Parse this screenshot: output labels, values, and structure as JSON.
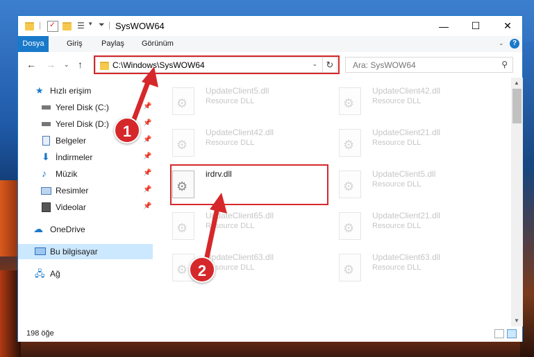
{
  "window": {
    "title": "SysWOW64"
  },
  "ribbon": {
    "tabs": [
      "Dosya",
      "Giriş",
      "Paylaş",
      "Görünüm"
    ]
  },
  "address": {
    "path": "C:\\Windows\\SysWOW64"
  },
  "search": {
    "placeholder": "Ara: SysWOW64"
  },
  "sidebar": {
    "items": [
      {
        "label": "Hızlı erişim",
        "icon": "star-icon"
      },
      {
        "label": "Yerel Disk (C:)",
        "icon": "drive-icon",
        "pinned": true
      },
      {
        "label": "Yerel Disk (D:)",
        "icon": "drive-icon",
        "pinned": true
      },
      {
        "label": "Belgeler",
        "icon": "documents-icon",
        "pinned": true
      },
      {
        "label": "İndirmeler",
        "icon": "download-icon",
        "pinned": true
      },
      {
        "label": "Müzik",
        "icon": "music-icon",
        "pinned": true
      },
      {
        "label": "Resimler",
        "icon": "pictures-icon",
        "pinned": true
      },
      {
        "label": "Videolar",
        "icon": "video-icon",
        "pinned": true
      },
      {
        "label": "OneDrive",
        "icon": "cloud-icon"
      },
      {
        "label": "Bu bilgisayar",
        "icon": "computer-icon",
        "selected": true
      },
      {
        "label": "Ağ",
        "icon": "network-icon"
      }
    ]
  },
  "files": [
    {
      "name": "UpdateClient5.dll",
      "type": "Resource DLL"
    },
    {
      "name": "UpdateClient42.dll",
      "type": "Resource DLL"
    },
    {
      "name": "UpdateClient42.dll",
      "type": "Resource DLL"
    },
    {
      "name": "UpdateClient21.dll",
      "type": "Resource DLL"
    },
    {
      "name": "irdrv.dll",
      "type": ""
    },
    {
      "name": "UpdateClient5.dll",
      "type": "Resource DLL"
    },
    {
      "name": "UpdateClient65.dll",
      "type": "Resource DLL"
    },
    {
      "name": "UpdateClient21.dll",
      "type": "Resource DLL"
    },
    {
      "name": "UpdateClient63.dll",
      "type": "Resource DLL"
    },
    {
      "name": "UpdateClient63.dll",
      "type": "Resource DLL"
    }
  ],
  "status": {
    "count": "198 öğe"
  },
  "annotations": {
    "step1": "1",
    "step2": "2",
    "color": "#d5282b"
  }
}
